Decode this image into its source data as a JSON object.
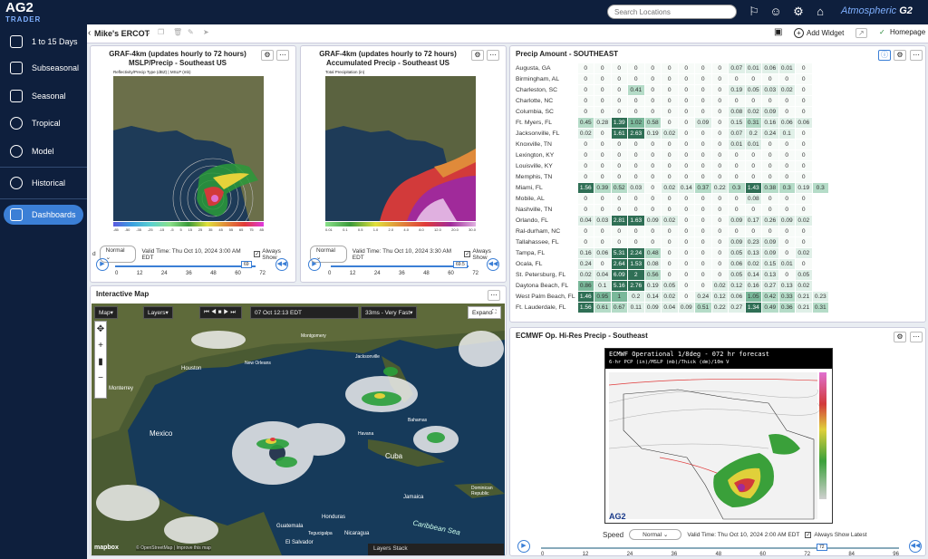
{
  "app": {
    "logo": "AG2",
    "logo_sub": "TRADER",
    "search_placeholder": "Search Locations",
    "brand_pre": "Atmospheric",
    "brand_post": "G2"
  },
  "sidebar": {
    "items": [
      {
        "label": "1 to 15 Days",
        "icon": "calendar-icon"
      },
      {
        "label": "Subseasonal",
        "icon": "calendar-grid-icon"
      },
      {
        "label": "Seasonal",
        "icon": "calendar-icon"
      },
      {
        "label": "Tropical",
        "icon": "hurricane-icon"
      },
      {
        "label": "Model",
        "icon": "globe-icon"
      },
      {
        "label": "Historical",
        "icon": "history-icon"
      },
      {
        "label": "Dashboards",
        "icon": "dashboard-icon"
      }
    ]
  },
  "toolbar": {
    "title": "Mike's ERCOT",
    "add_widget": "Add Widget",
    "homepage": "Homepage"
  },
  "graf1": {
    "title": "GRAF-4km (updates hourly to 72 hours) MSLP/Precip - Southeast US",
    "inner_title": "Reflectivity/Precip Type (dBZ) | MSLP (mb)",
    "valid": "Valid Time: Thu Oct 10, 2024 3:00 AM EDT",
    "always_show": "Always Show",
    "speed": "Normal",
    "slider_label": "69",
    "ticks": [
      "0",
      "12",
      "24",
      "36",
      "48",
      "60",
      "72"
    ],
    "scale": [
      "-85",
      "-50",
      "-35",
      "-25",
      "-15",
      "-5",
      "5",
      "15",
      "25",
      "35",
      "45",
      "55",
      "65",
      "75",
      "85"
    ]
  },
  "graf2": {
    "title": "GRAF-4km (updates hourly to 72 hours) Accumulated Precip - Southeast US",
    "inner_title": "Total Precipitation (in)",
    "valid": "Valid Time: Thu Oct 10, 2024 3:30 AM EDT",
    "always_show": "Always Show",
    "speed": "Normal",
    "slider_label": "69.5",
    "ticks": [
      "0",
      "12",
      "24",
      "36",
      "48",
      "60",
      "72"
    ],
    "scale": [
      "0.01",
      "0.1",
      "0.5",
      "1.0",
      "2.0",
      "4.0",
      "8.0",
      "12.0",
      "20.0",
      "30.0"
    ]
  },
  "precip": {
    "title": "Precip Amount - SOUTHEAST",
    "rows": [
      {
        "city": "Augusta, GA",
        "v": [
          "0",
          "0",
          "0",
          "0",
          "0",
          "0",
          "0",
          "0",
          "0",
          "0.07",
          "0.01",
          "0.06",
          "0.01",
          "0"
        ]
      },
      {
        "city": "Birmingham, AL",
        "v": [
          "0",
          "0",
          "0",
          "0",
          "0",
          "0",
          "0",
          "0",
          "0",
          "0",
          "0",
          "0",
          "0",
          "0"
        ]
      },
      {
        "city": "Charleston, SC",
        "v": [
          "0",
          "0",
          "0",
          "0.41",
          "0",
          "0",
          "0",
          "0",
          "0",
          "0.19",
          "0.05",
          "0.03",
          "0.02",
          "0"
        ]
      },
      {
        "city": "Charlotte, NC",
        "v": [
          "0",
          "0",
          "0",
          "0",
          "0",
          "0",
          "0",
          "0",
          "0",
          "0",
          "0",
          "0",
          "0",
          "0"
        ]
      },
      {
        "city": "Columbia, SC",
        "v": [
          "0",
          "0",
          "0",
          "0",
          "0",
          "0",
          "0",
          "0",
          "0",
          "0.08",
          "0.02",
          "0.09",
          "0",
          "0"
        ]
      },
      {
        "city": "Ft. Myers, FL",
        "v": [
          "0.45",
          "0.28",
          "1.39",
          "1.02",
          "0.58",
          "0",
          "0",
          "0.09",
          "0",
          "0.15",
          "0.31",
          "0.16",
          "0.06",
          "0.06"
        ]
      },
      {
        "city": "Jacksonville, FL",
        "v": [
          "0.02",
          "0",
          "1.61",
          "2.63",
          "0.19",
          "0.02",
          "0",
          "0",
          "0",
          "0.07",
          "0.2",
          "0.24",
          "0.1",
          "0"
        ]
      },
      {
        "city": "Knoxville, TN",
        "v": [
          "0",
          "0",
          "0",
          "0",
          "0",
          "0",
          "0",
          "0",
          "0",
          "0.01",
          "0.01",
          "0",
          "0",
          "0"
        ]
      },
      {
        "city": "Lexington, KY",
        "v": [
          "0",
          "0",
          "0",
          "0",
          "0",
          "0",
          "0",
          "0",
          "0",
          "0",
          "0",
          "0",
          "0",
          "0"
        ]
      },
      {
        "city": "Louisville, KY",
        "v": [
          "0",
          "0",
          "0",
          "0",
          "0",
          "0",
          "0",
          "0",
          "0",
          "0",
          "0",
          "0",
          "0",
          "0"
        ]
      },
      {
        "city": "Memphis, TN",
        "v": [
          "0",
          "0",
          "0",
          "0",
          "0",
          "0",
          "0",
          "0",
          "0",
          "0",
          "0",
          "0",
          "0",
          "0"
        ]
      },
      {
        "city": "Miami, FL",
        "v": [
          "1.56",
          "0.39",
          "0.52",
          "0.03",
          "0",
          "0.02",
          "0.14",
          "0.37",
          "0.22",
          "0.3",
          "1.43",
          "0.38",
          "0.3",
          "0.19",
          "0.3"
        ]
      },
      {
        "city": "Mobile, AL",
        "v": [
          "0",
          "0",
          "0",
          "0",
          "0",
          "0",
          "0",
          "0",
          "0",
          "0",
          "0.08",
          "0",
          "0",
          "0"
        ]
      },
      {
        "city": "Nashville, TN",
        "v": [
          "0",
          "0",
          "0",
          "0",
          "0",
          "0",
          "0",
          "0",
          "0",
          "0",
          "0",
          "0",
          "0",
          "0"
        ]
      },
      {
        "city": "Orlando, FL",
        "v": [
          "0.04",
          "0.03",
          "2.81",
          "1.63",
          "0.09",
          "0.02",
          "0",
          "0",
          "0",
          "0.09",
          "0.17",
          "0.26",
          "0.09",
          "0.02"
        ]
      },
      {
        "city": "Ral-durham, NC",
        "v": [
          "0",
          "0",
          "0",
          "0",
          "0",
          "0",
          "0",
          "0",
          "0",
          "0",
          "0",
          "0",
          "0",
          "0"
        ]
      },
      {
        "city": "Tallahassee, FL",
        "v": [
          "0",
          "0",
          "0",
          "0",
          "0",
          "0",
          "0",
          "0",
          "0",
          "0.09",
          "0.23",
          "0.09",
          "0",
          "0"
        ]
      },
      {
        "city": "Tampa, FL",
        "v": [
          "0.16",
          "0.06",
          "5.31",
          "2.24",
          "0.48",
          "0",
          "0",
          "0",
          "0",
          "0.05",
          "0.13",
          "0.09",
          "0",
          "0.02"
        ]
      },
      {
        "city": "Ocala, FL",
        "v": [
          "0.24",
          "0",
          "2.64",
          "1.53",
          "0.08",
          "0",
          "0",
          "0",
          "0",
          "0.06",
          "0.02",
          "0.15",
          "0.01",
          "0"
        ]
      },
      {
        "city": "St. Petersburg, FL",
        "v": [
          "0.02",
          "0.04",
          "6.09",
          "2",
          "0.56",
          "0",
          "0",
          "0",
          "0",
          "0.05",
          "0.14",
          "0.13",
          "0",
          "0.05"
        ]
      },
      {
        "city": "Daytona Beach, FL",
        "v": [
          "0.86",
          "0.1",
          "5.16",
          "2.76",
          "0.19",
          "0.05",
          "0",
          "0",
          "0.02",
          "0.12",
          "0.16",
          "0.27",
          "0.13",
          "0.02"
        ]
      },
      {
        "city": "West Palm Beach, FL",
        "v": [
          "1.46",
          "0.95",
          "1",
          "0.2",
          "0.14",
          "0.02",
          "0",
          "0.24",
          "0.12",
          "0.06",
          "1.05",
          "0.42",
          "0.33",
          "0.21",
          "0.23"
        ]
      },
      {
        "city": "Ft. Lauderdale, FL",
        "v": [
          "1.56",
          "0.61",
          "0.67",
          "0.11",
          "0.09",
          "0.04",
          "0.09",
          "0.51",
          "0.22",
          "0.27",
          "1.34",
          "0.49",
          "0.36",
          "0.21",
          "0.31"
        ]
      }
    ]
  },
  "imap": {
    "title": "Interactive Map",
    "map_label": "Map",
    "layers_label": "Layers",
    "time": "07 Oct 12:13 EDT",
    "speed": "33ms - Very Fast",
    "expand": "Expand",
    "layers_stack": "Layers Stack",
    "attribution": "© OpenStreetMap | Improve this map",
    "mapbox": "mapbox",
    "labels": [
      "Houston",
      "Monterrey",
      "Mexico",
      "Cuba",
      "Jamaica",
      "Guatemala",
      "Honduras",
      "El Salvador",
      "Nicaragua",
      "Caribbean Sea",
      "Dominican Republic",
      "Tegucigalpa",
      "Havana",
      "Bahamas",
      "Jacksonville",
      "Montgomery",
      "New Orleans"
    ]
  },
  "ecmwf": {
    "title": "ECMWF Op. Hi-Res Precip - Southeast",
    "img_title": "ECMWF Operational 1/8deg - 072 hr forecast",
    "img_sub": "6-hr PCP (in)/MSLP (mb)/Thick (dm)/10m V",
    "valid": "Valid Time: Thu Oct 10, 2024 2:00 AM EDT",
    "always_show": "Always Show Latest",
    "speed_label": "Speed",
    "speed": "Normal",
    "slider_label": "72",
    "ticks": [
      "0",
      "12",
      "24",
      "36",
      "48",
      "60",
      "72",
      "84",
      "96"
    ]
  }
}
